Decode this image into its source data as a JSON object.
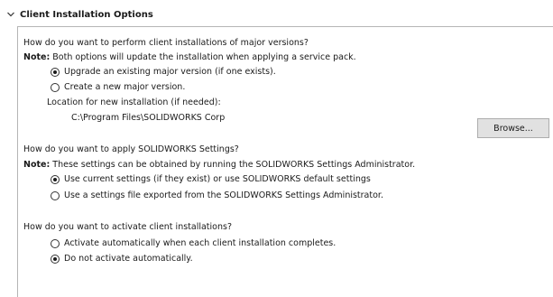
{
  "section": {
    "title": "Client Installation Options",
    "icon": "chevron-down-icon"
  },
  "major_versions": {
    "question": "How do you want to perform client installations of major versions?",
    "note_label": "Note:",
    "note_text": " Both options will update the installation when applying a service pack.",
    "options": [
      {
        "label": "Upgrade an existing major version (if one exists).",
        "checked": true
      },
      {
        "label": "Create a new major version.",
        "checked": false
      }
    ],
    "location_label": "Location for new installation (if needed):",
    "location_value": "C:\\Program Files\\SOLIDWORKS Corp",
    "browse_label": "Browse..."
  },
  "settings": {
    "question": "How do you want to apply SOLIDWORKS Settings?",
    "note_label": "Note:",
    "note_text": " These settings can be obtained by running the SOLIDWORKS Settings Administrator.",
    "options": [
      {
        "label": "Use current settings (if they exist) or use SOLIDWORKS default settings",
        "checked": true
      },
      {
        "label": "Use a settings file exported from the SOLIDWORKS Settings Administrator.",
        "checked": false
      }
    ]
  },
  "activation": {
    "question": "How do you want to activate client installations?",
    "options": [
      {
        "label": "Activate automatically when each client installation completes.",
        "checked": false
      },
      {
        "label": "Do not activate automatically.",
        "checked": true
      }
    ]
  }
}
